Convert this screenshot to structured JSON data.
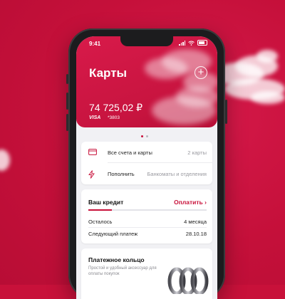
{
  "status": {
    "time": "9:41"
  },
  "header": {
    "title": "Карты",
    "add_icon": "plus-circle-icon"
  },
  "card": {
    "balance": "74 725,02 ₽",
    "brand": "VISA",
    "number": "*3803"
  },
  "carousel": {
    "pages": 2,
    "active": 0
  },
  "menu": [
    {
      "icon": "card-icon",
      "label": "Все счета и карты",
      "meta": "2 карты"
    },
    {
      "icon": "lightning-icon",
      "label": "Пополнить",
      "meta": "Банкоматы и отделения"
    }
  ],
  "credit": {
    "title": "Ваш кредит",
    "pay_label": "Оплатить",
    "progress": 0.2,
    "rows": [
      {
        "label": "Осталось",
        "value": "4 месяца"
      },
      {
        "label": "Следующий платеж",
        "value": "28.10.18"
      }
    ]
  },
  "ring": {
    "title": "Платежное кольцо",
    "description": "Простой и удобный аксессуар для оплаты покупок"
  },
  "colors": {
    "brand": "#c8113a",
    "background": "#c8113a"
  }
}
